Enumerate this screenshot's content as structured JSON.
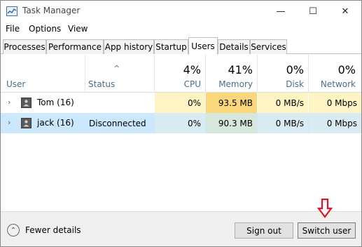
{
  "window": {
    "title": "Task Manager",
    "controls": {
      "minimize": "—",
      "maximize": "☐",
      "close": "✕"
    }
  },
  "menu": [
    "File",
    "Options",
    "View"
  ],
  "tabs": [
    "Processes",
    "Performance",
    "App history",
    "Startup",
    "Users",
    "Details",
    "Services"
  ],
  "active_tab": "Users",
  "columns": {
    "user": "User",
    "status": "Status",
    "cpu": {
      "pct": "4%",
      "label": "CPU"
    },
    "memory": {
      "pct": "41%",
      "label": "Memory"
    },
    "disk": {
      "pct": "0%",
      "label": "Disk"
    },
    "network": {
      "pct": "0%",
      "label": "Network"
    },
    "sort_arrow": "^"
  },
  "rows": [
    {
      "expand": "›",
      "user": "Tom (16)",
      "status": "",
      "cpu": "0%",
      "memory": "93.5 MB",
      "disk": "0 MB/s",
      "network": "0 Mbps",
      "selected": false
    },
    {
      "expand": "›",
      "user": "jack (16)",
      "status": "Disconnected",
      "cpu": "0%",
      "memory": "90.3 MB",
      "disk": "0 MB/s",
      "network": "0 Mbps",
      "selected": true
    }
  ],
  "footer": {
    "fewer_details": "Fewer details",
    "fewer_icon": "⌃",
    "sign_out": "Sign out",
    "switch_user": "Switch user"
  },
  "colors": {
    "heat_light": "#fff4c4",
    "heat_mid": "#ffe8a0",
    "heat_strong": "#f9d77a",
    "selected_row": "#cce8ff",
    "annotation_red": "#e81123"
  },
  "icons": {
    "app": "task-manager-icon",
    "avatar": "user-avatar-icon",
    "annotation": "red-down-arrow-icon"
  }
}
